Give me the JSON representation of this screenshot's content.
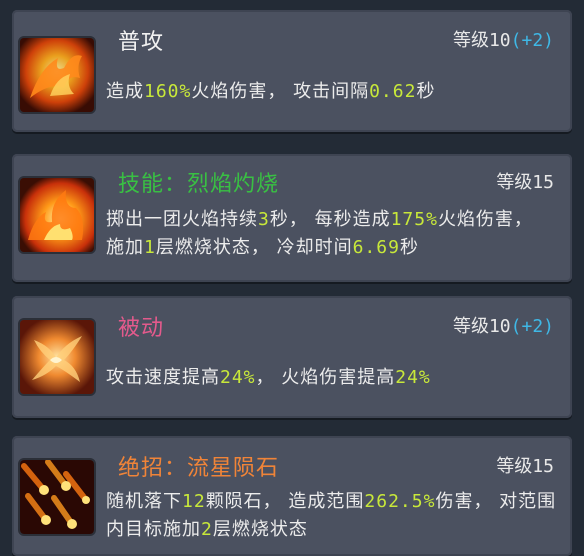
{
  "skills": [
    {
      "icon": "phoenix-icon",
      "name": "普攻",
      "level_label": "等级10",
      "level_bonus": "(+2)",
      "desc": {
        "t1": "造成",
        "v1": "160%",
        "t2": "火焰伤害， 攻击间隔",
        "v2": "0.62",
        "t3": "秒"
      }
    },
    {
      "icon": "fire-burst-icon",
      "name": "技能：烈焰灼烧",
      "level_label": "等级15",
      "desc": {
        "t1": "掷出一团火焰持续",
        "v1": "3",
        "t2": "秒， 每秒造成",
        "v2": "175%",
        "t3": "火焰伤害， 施加",
        "v3": "1",
        "t4": "层燃烧状态， 冷却时间",
        "v4": "6.69",
        "t5": "秒"
      }
    },
    {
      "icon": "flame-bird-icon",
      "name": "被动",
      "level_label": "等级10",
      "level_bonus": "(+2)",
      "desc": {
        "t1": "攻击速度提高",
        "v1": "24%",
        "t2": "， 火焰伤害提高",
        "v2": "24%"
      }
    },
    {
      "icon": "meteor-icon",
      "name": "绝招：流星陨石",
      "level_label": "等级15",
      "desc": {
        "t1": "随机落下",
        "v1": "12",
        "t2": "颗陨石， 造成范围",
        "v2": "262.5%",
        "t3": "伤害， 对范围内目标施加",
        "v3": "2",
        "t4": "层燃烧状态"
      }
    }
  ],
  "colors": {
    "background": "#232b36",
    "card": "#4b5160",
    "highlight": "#c8e83a",
    "bonus": "#3fb8e6",
    "skill_name": "#39c043",
    "passive_name": "#e35a8c",
    "ultimate_name": "#f08438"
  }
}
